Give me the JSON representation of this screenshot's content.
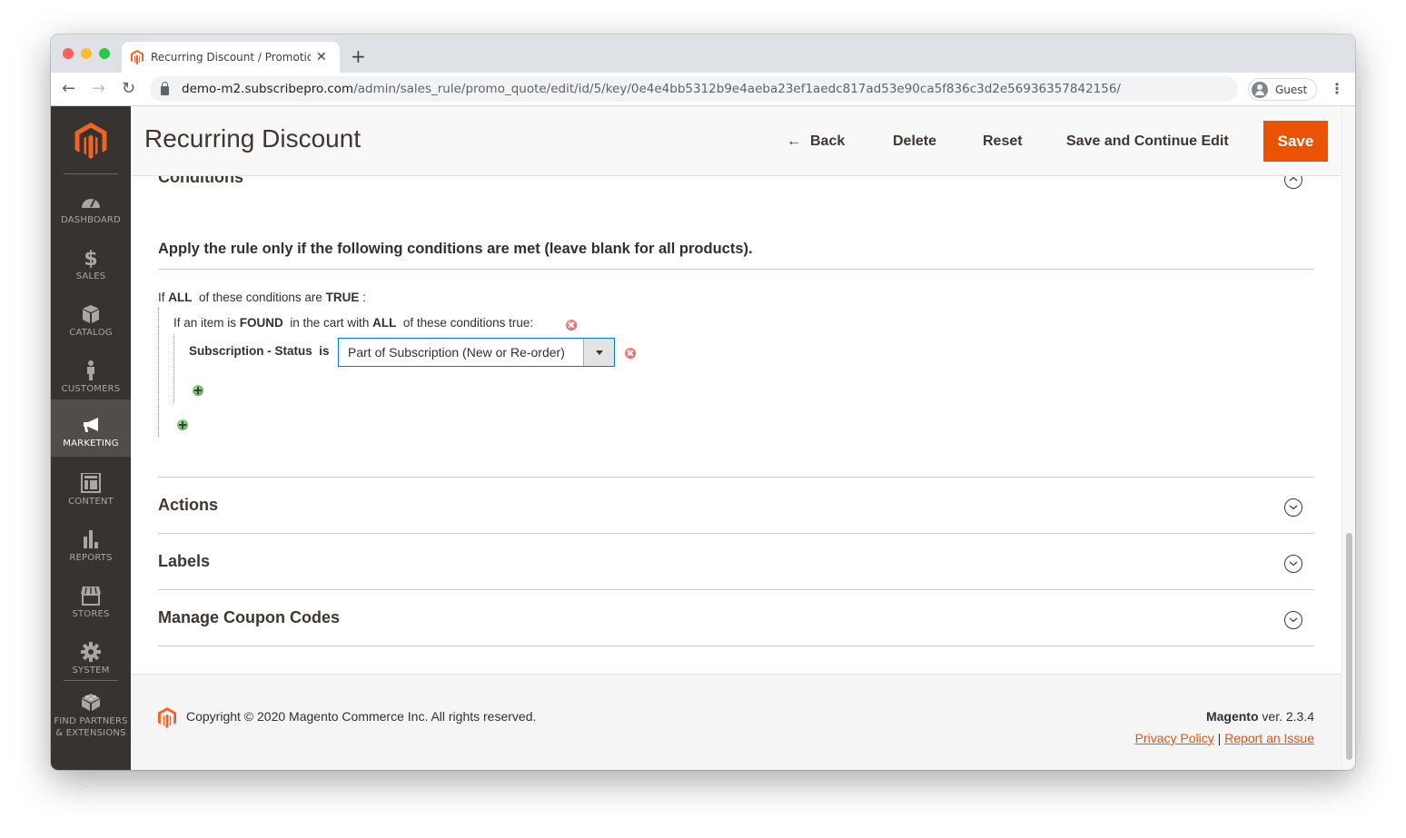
{
  "browser": {
    "tab_title": "Recurring Discount / Promotion",
    "new_tab_label": "+",
    "url_host": "demo-m2.subscribepro.com",
    "url_path": "/admin/sales_rule/promo_quote/edit/id/5/key/0e4e4bb5312b9e4aeba23ef1aedc817ad53e90ca5f836c3d2e56936357842156/",
    "profile_label": "Guest"
  },
  "sidebar": {
    "items": [
      {
        "label": "DASHBOARD",
        "icon": "dashboard-icon"
      },
      {
        "label": "SALES",
        "icon": "dollar-icon"
      },
      {
        "label": "CATALOG",
        "icon": "box-icon"
      },
      {
        "label": "CUSTOMERS",
        "icon": "person-icon"
      },
      {
        "label": "MARKETING",
        "icon": "megaphone-icon",
        "active": true
      },
      {
        "label": "CONTENT",
        "icon": "layout-icon"
      },
      {
        "label": "REPORTS",
        "icon": "bar-chart-icon"
      },
      {
        "label": "STORES",
        "icon": "storefront-icon"
      },
      {
        "label": "SYSTEM",
        "icon": "gear-icon"
      },
      {
        "label_line1": "FIND PARTNERS",
        "label_line2": "& EXTENSIONS",
        "icon": "lego-brick-icon"
      }
    ]
  },
  "header": {
    "title": "Recurring Discount",
    "back_label": "Back",
    "delete_label": "Delete",
    "reset_label": "Reset",
    "save_continue_label": "Save and Continue Edit",
    "save_label": "Save"
  },
  "conditions": {
    "section_title": "Conditions",
    "legend": "Apply the rule only if the following conditions are met (leave blank for all products).",
    "root": {
      "prefix": "If ",
      "aggregator": "ALL",
      "middle": "  of these conditions are ",
      "value": "TRUE",
      "suffix": " :"
    },
    "found": {
      "prefix": "If an item is ",
      "found_value": "FOUND",
      "middle": "  in the cart with ",
      "aggregator": "ALL",
      "suffix": "  of these conditions true: "
    },
    "condition": {
      "attribute": "Subscription - Status",
      "operator": "is",
      "value": "Part of Subscription (New or Re-order)"
    }
  },
  "sections": [
    {
      "title": "Actions"
    },
    {
      "title": "Labels"
    },
    {
      "title": "Manage Coupon Codes"
    }
  ],
  "footer": {
    "copyright": "Copyright © 2020 Magento Commerce Inc. All rights reserved.",
    "brand": "Magento",
    "version": " ver. 2.3.4",
    "privacy_label": "Privacy Policy",
    "separator": " | ",
    "report_label": "Report an Issue"
  },
  "colors": {
    "accent": "#eb5202",
    "sidebar_bg": "#373330",
    "sidebar_active": "#524d49",
    "select_border": "#007bdb"
  }
}
